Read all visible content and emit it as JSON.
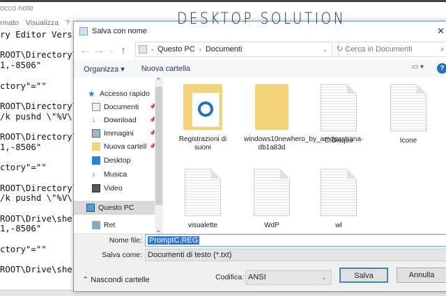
{
  "notepad": {
    "title": "occo note",
    "menu": [
      "rmato",
      "Visualizza",
      "?"
    ],
    "lines": [
      "ry Editor Versio",
      "",
      "ROOT\\Directory\\s",
      "1,-8506\"",
      "",
      "ctory\"=\"\"",
      "",
      "ROOT\\Directory\\s",
      "/k pushd \\\"%V\\\"\"",
      "",
      "ROOT\\Directory\\B",
      "1,-8506\"",
      "",
      "ctory\"=\"\"",
      "",
      "ROOT\\Directory\\B",
      "/k pushd \\\"%V\\\"\"",
      "",
      "ROOT\\Drive\\shell",
      "1,-8506\"",
      "",
      "ctory\"=\"\"",
      "",
      "ROOT\\Drive\\shell"
    ]
  },
  "watermark": "DESKTOP SOLUTION",
  "dialog": {
    "title": "Salva con nome",
    "breadcrumb": [
      "Questo PC",
      "Documenti"
    ],
    "search_placeholder": "Cerca in Documenti",
    "toolbar": {
      "organize": "Organizza ▾",
      "new_folder": "Nuova cartella"
    },
    "sidebar": [
      "Accesso rapido",
      "Documenti",
      "Download",
      "Immagini",
      "Nuova cartell",
      "Desktop",
      "Musica",
      "Video",
      "Questo PC",
      "Ret"
    ],
    "files": [
      "Registrazioni di suoni",
      "windows10newhero_by_amdpastrana-db1a83d",
      "C.Disqus",
      "Icone",
      "visualette",
      "WdP",
      "wl"
    ],
    "filename_label": "Nome file:",
    "filename": "PromptC.REG",
    "savetype_label": "Salva come:",
    "savetype": "Documenti di testo (*.txt)",
    "hide_folders": "Nascondi cartelle",
    "encoding_label": "Codifica:",
    "encoding": "ANSI",
    "save": "Salva",
    "cancel": "Annulla"
  }
}
